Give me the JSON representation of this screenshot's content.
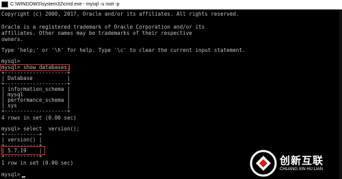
{
  "window": {
    "title": "C:\\WINDOWS\\system32\\cmd.exe - mysql  -u root -p"
  },
  "console": {
    "lines": [
      "",
      "Copyright (c) 2000, 2017, Oracle and/or its affiliates. All rights reserved.",
      "",
      "Oracle is a registered trademark of Oracle Corporation and/or its",
      "affiliates. Other names may be trademarks of their respective",
      "owners.",
      "",
      "Type 'help;' or '\\h' for help. Type '\\c' to clear the current input statement.",
      "",
      "mysql>",
      "mysql> show databases;",
      "+--------------------+",
      "| Database           |",
      "+--------------------+",
      "| information_schema |",
      "| mysql              |",
      "| performance_schema |",
      "| sys                |",
      "+--------------------+",
      "4 rows in set (0.00 sec)",
      "",
      "mysql> select  version();",
      "+-----------+",
      "| version() |",
      "+-----------+",
      "| 5.7.19    |",
      "+-----------+",
      "1 row in set (0.00 sec)",
      "",
      "mysql>"
    ]
  },
  "watermark": {
    "name_cn": "创新互联",
    "name_en": "CHUANG XIN HU LIAN"
  },
  "colors": {
    "console_bg": "#000000",
    "console_text": "#c0c0c0",
    "highlight": "#e03030",
    "logo_accent": "#ffffff"
  }
}
